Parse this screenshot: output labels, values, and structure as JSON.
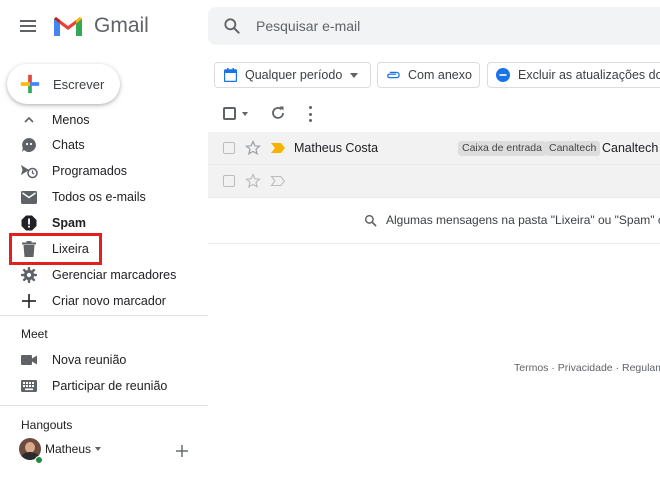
{
  "app": {
    "name": "Gmail"
  },
  "colors": {
    "accent_red": "#e32020",
    "important_marker": "#f4b400",
    "online": "#1e8e3e"
  },
  "search": {
    "placeholder": "Pesquisar e-mail"
  },
  "compose": {
    "label": "Escrever"
  },
  "sidebar": {
    "items": [
      {
        "label": "Menos",
        "icon": "chevron-up-icon"
      },
      {
        "label": "Chats",
        "icon": "chat-icon"
      },
      {
        "label": "Programados",
        "icon": "scheduled-icon"
      },
      {
        "label": "Todos os e-mails",
        "icon": "mail-icon"
      },
      {
        "label": "Spam",
        "icon": "spam-icon"
      },
      {
        "label": "Lixeira",
        "icon": "trash-icon"
      },
      {
        "label": "Gerenciar marcadores",
        "icon": "gear-icon"
      },
      {
        "label": "Criar novo marcador",
        "icon": "plus-icon"
      }
    ]
  },
  "meet": {
    "title": "Meet",
    "items": [
      {
        "label": "Nova reunião",
        "icon": "video-icon"
      },
      {
        "label": "Participar de reunião",
        "icon": "keyboard-icon"
      }
    ]
  },
  "hangouts": {
    "title": "Hangouts",
    "user": "Matheus"
  },
  "filters": [
    {
      "label": "Qualquer período",
      "icon": "calendar-icon"
    },
    {
      "label": "Com anexo",
      "icon": "attachment-icon"
    },
    {
      "label": "Excluir as atualizações do",
      "icon": "remove-circle-icon"
    }
  ],
  "messages": [
    {
      "sender": "Matheus Costa",
      "labels": [
        "Caixa de entrada",
        "Canaltech"
      ],
      "subject": "Canaltech -"
    },
    {
      "sender": "",
      "labels": [],
      "subject": ""
    }
  ],
  "notice": "Algumas mensagens na pasta \"Lixeira\" ou \"Spam\" corre",
  "footer": {
    "terms": "Termos",
    "separator": "·",
    "privacy": "Privacidade",
    "rules": "Regulame"
  }
}
